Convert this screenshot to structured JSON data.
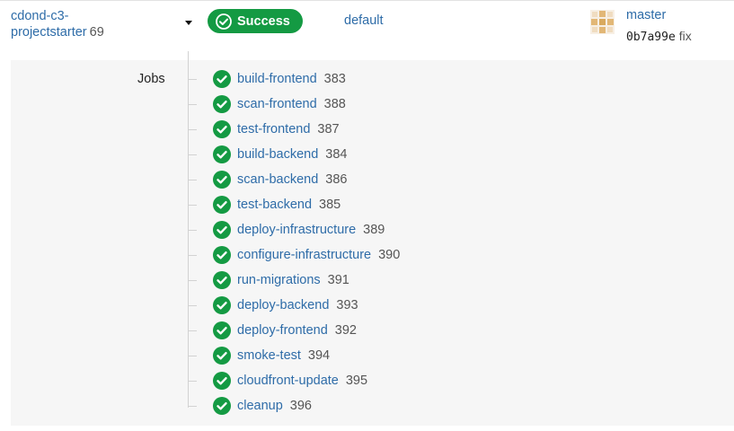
{
  "header": {
    "project_name": "cdond-c3-projectstarter",
    "build_number": "69",
    "status_label": "Success",
    "workflow_name": "default",
    "branch": "master",
    "commit_sha": "0b7a99e",
    "commit_message": "fix"
  },
  "colors": {
    "success": "#149a43",
    "link": "#2e6ca8",
    "panel_background": "#f6f6f6"
  },
  "icons": {
    "status": "check-circle-icon",
    "dropdown": "caret-down-icon",
    "avatar": "identicon-avatar"
  },
  "jobs": {
    "heading": "Jobs",
    "items": [
      {
        "name": "build-frontend",
        "number": "383"
      },
      {
        "name": "scan-frontend",
        "number": "388"
      },
      {
        "name": "test-frontend",
        "number": "387"
      },
      {
        "name": "build-backend",
        "number": "384"
      },
      {
        "name": "scan-backend",
        "number": "386"
      },
      {
        "name": "test-backend",
        "number": "385"
      },
      {
        "name": "deploy-infrastructure",
        "number": "389"
      },
      {
        "name": "configure-infrastructure",
        "number": "390"
      },
      {
        "name": "run-migrations",
        "number": "391"
      },
      {
        "name": "deploy-backend",
        "number": "393"
      },
      {
        "name": "deploy-frontend",
        "number": "392"
      },
      {
        "name": "smoke-test",
        "number": "394"
      },
      {
        "name": "cloudfront-update",
        "number": "395"
      },
      {
        "name": "cleanup",
        "number": "396"
      }
    ]
  }
}
